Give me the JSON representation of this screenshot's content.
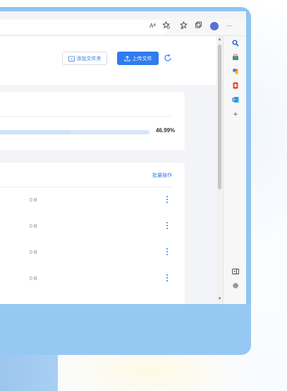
{
  "browser": {
    "read_aloud_label": "Aᴬ",
    "icons": [
      "read-aloud-icon",
      "favorite-add-icon",
      "favorites-icon",
      "collections-icon",
      "profile-avatar",
      "more-icon"
    ],
    "more_label": "···"
  },
  "sidebar": {
    "add_label": "+"
  },
  "header": {
    "add_folder_label": "添加文件夹",
    "upload_label": "上传文件"
  },
  "storage": {
    "used_percent": 46.99,
    "percent_label": "46.99%"
  },
  "files": {
    "batch_label": "批量操作",
    "rows": [
      {
        "size": "0 B"
      },
      {
        "size": "0 B"
      },
      {
        "size": "0 B"
      },
      {
        "size": "0 B"
      }
    ]
  },
  "colors": {
    "accent": "#2f7cf0",
    "monitor": "#90c4f2",
    "progress_track": "#d6e6fb"
  }
}
